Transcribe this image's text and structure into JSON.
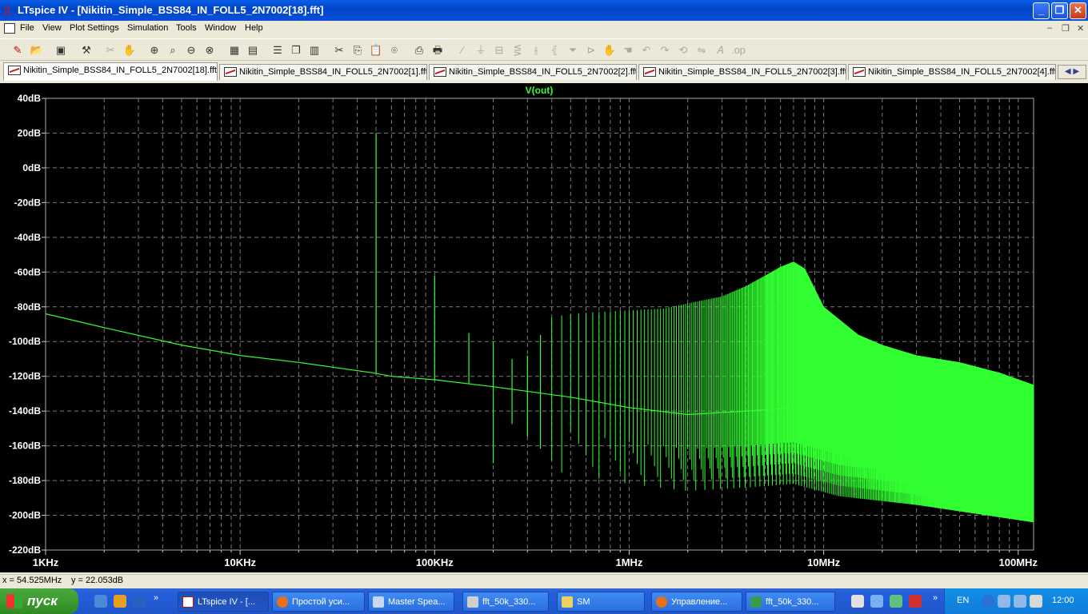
{
  "window": {
    "title": "LTspice IV - [Nikitin_Simple_BSS84_IN_FOLL5_2N7002[18].fft]",
    "minimize": "_",
    "restore": "❐",
    "close": "✕"
  },
  "menu": {
    "items": [
      "File",
      "View",
      "Plot Settings",
      "Simulation",
      "Tools",
      "Window",
      "Help"
    ],
    "mdi_minimize": "–",
    "mdi_restore": "❐",
    "mdi_close": "✕"
  },
  "tabs": {
    "items": [
      "Nikitin_Simple_BSS84_IN_FOLL5_2N7002[18].fft",
      "Nikitin_Simple_BSS84_IN_FOLL5_2N7002[1].fft",
      "Nikitin_Simple_BSS84_IN_FOLL5_2N7002[2].fft",
      "Nikitin_Simple_BSS84_IN_FOLL5_2N7002[3].fft",
      "Nikitin_Simple_BSS84_IN_FOLL5_2N7002[4].fft"
    ],
    "scroll": "◀ ▶"
  },
  "colors": {
    "trace": "#33FF33",
    "plot_bg": "#000000",
    "grid": "#7a7a7a",
    "title_green": "#33FF33"
  },
  "chart_data": {
    "type": "line",
    "title": "V(out)",
    "x_scale": "log",
    "xlim_hz": [
      1000,
      120000000
    ],
    "ylim": [
      -220,
      40
    ],
    "y_ticks": [
      "40dB",
      "20dB",
      "0dB",
      "-20dB",
      "-40dB",
      "-60dB",
      "-80dB",
      "-100dB",
      "-120dB",
      "-140dB",
      "-160dB",
      "-180dB",
      "-200dB",
      "-220dB"
    ],
    "x_ticks": [
      "1KHz",
      "10KHz",
      "100KHz",
      "1MHz",
      "10MHz",
      "100MHz"
    ],
    "grid": true,
    "series": [
      {
        "name": "V(out)",
        "noise_floor": {
          "x_hz": [
            1000,
            2000,
            5000,
            10000,
            20000,
            48000,
            60000,
            100000,
            200000,
            500000,
            1000000,
            2000000,
            4000000,
            7000000,
            12000000,
            30000000,
            60000000,
            120000000
          ],
          "y_db": [
            -84,
            -92,
            -102,
            -108,
            -112,
            -118,
            -120,
            -122,
            -126,
            -132,
            -138,
            -142,
            -140,
            -138,
            -145,
            -150,
            -155,
            -160
          ]
        },
        "harmonics": {
          "x_hz": [
            50000,
            100000,
            150000,
            200000,
            250000,
            300000,
            400000,
            500000,
            700000,
            1000000,
            1500000,
            2000000,
            3000000,
            4000000,
            5000000,
            6000000,
            7000000,
            8000000,
            10000000,
            15000000,
            20000000,
            30000000,
            50000000,
            80000000,
            120000000
          ],
          "y_db": [
            20,
            -62,
            -95,
            -100,
            -110,
            -108,
            -86,
            -84,
            -83,
            -82,
            -81,
            -78,
            -74,
            -68,
            -62,
            -57,
            -54,
            -58,
            -80,
            -96,
            -102,
            -108,
            -112,
            -118,
            -125
          ]
        }
      }
    ]
  },
  "status": {
    "x_readout": "x = 54.525MHz",
    "y_readout": "y = 22.053dB"
  },
  "taskbar": {
    "start": "пуск",
    "tasks": [
      "LTspice IV - [...",
      "Простой уси...",
      "Master Spea...",
      "fft_50k_330...",
      "SM",
      "Управление...",
      "fft_50k_330..."
    ],
    "lang": "EN",
    "clock": "12:00"
  }
}
